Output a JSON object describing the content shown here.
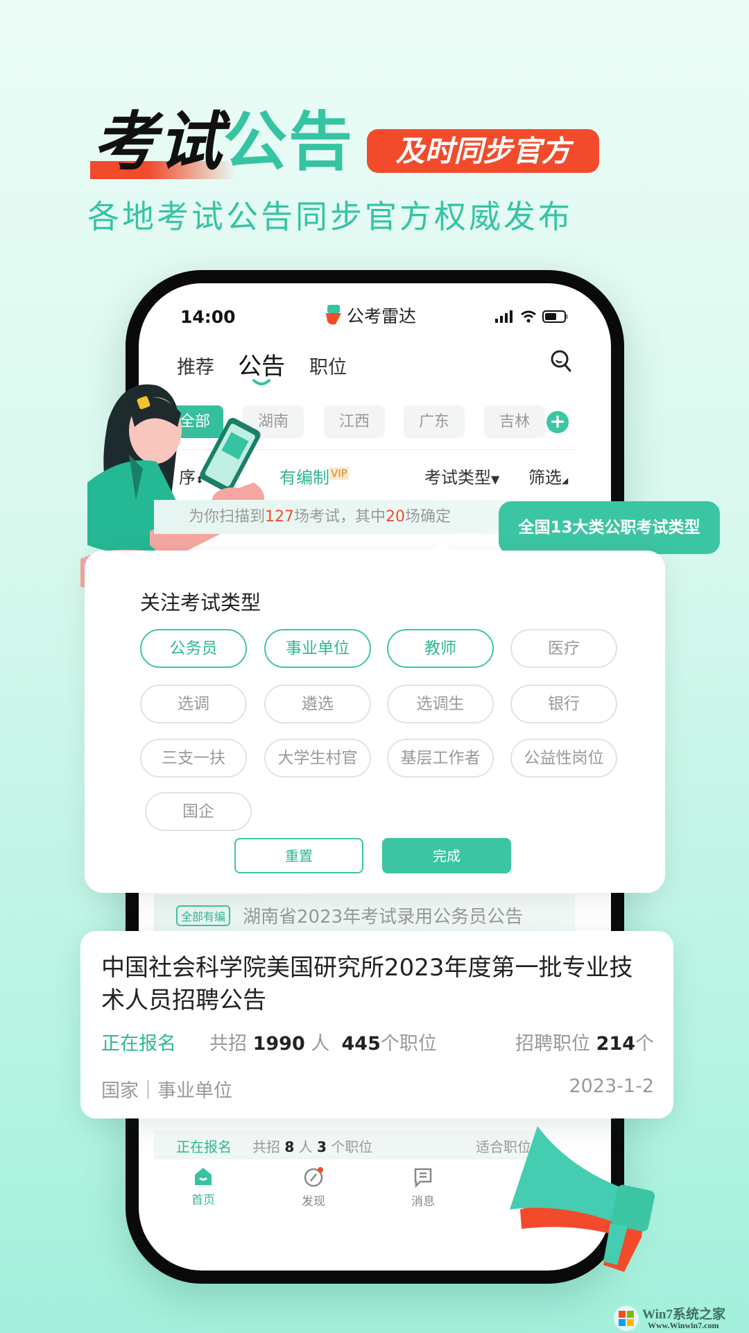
{
  "hero": {
    "title_dark": "考试",
    "title_green": "公告",
    "badge": "及时同步官方",
    "subtitle": "各地考试公告同步官方权威发布"
  },
  "status_bar": {
    "time": "14:00",
    "app_name": "公考雷达"
  },
  "top_tabs": [
    {
      "label": "推荐"
    },
    {
      "label": "公告",
      "active": true
    },
    {
      "label": "职位"
    }
  ],
  "regions": [
    {
      "label": "全部",
      "active": true
    },
    {
      "label": "湖南"
    },
    {
      "label": "江西"
    },
    {
      "label": "广东"
    },
    {
      "label": "吉林"
    }
  ],
  "filters": {
    "sort": "序",
    "only_bianzhi": "有编制",
    "vip": "VIP",
    "exam_type": "考试类型",
    "filter": "筛选"
  },
  "scan": {
    "prefix": "为你扫描到",
    "count1": "127",
    "mid": "场考试，其中",
    "count2": "20",
    "suffix": "场确定"
  },
  "tooltip": "全国13大类公职考试类型",
  "popup": {
    "title": "关注考试类型",
    "options": [
      {
        "label": "公务员",
        "selected": true
      },
      {
        "label": "事业单位",
        "selected": true
      },
      {
        "label": "教师",
        "selected": true
      },
      {
        "label": "医疗"
      },
      {
        "label": "选调"
      },
      {
        "label": "遴选"
      },
      {
        "label": "选调生"
      },
      {
        "label": "银行"
      },
      {
        "label": "三支一扶"
      },
      {
        "label": "大学生村官"
      },
      {
        "label": "基层工作者"
      },
      {
        "label": "公益性岗位"
      },
      {
        "label": "国企"
      }
    ],
    "reset": "重置",
    "done": "完成"
  },
  "list_bg": {
    "tag": "全部有编",
    "title": "湖南省2023年考试录用公务员公告",
    "status": "正在报名",
    "recruit_prefix": "共招",
    "people": "8",
    "people_unit": "人",
    "positions": "3",
    "positions_unit": "个职位",
    "fit": "适合职位"
  },
  "card": {
    "title": "中国社会科学院美国研究所2023年度第一批专业技术人员招聘公告",
    "status": "正在报名",
    "recruit_prefix": "共招",
    "people": "1990",
    "people_unit": "人",
    "positions": "445",
    "positions_unit": "个职位",
    "job_label": "招聘职位",
    "job_count": "214",
    "job_unit": "个",
    "category": "国家｜事业单位",
    "date": "2023-1-2"
  },
  "tabbar": [
    {
      "label": "首页",
      "active": true,
      "icon": "home-icon"
    },
    {
      "label": "发现",
      "icon": "compass-icon"
    },
    {
      "label": "消息",
      "icon": "message-icon"
    }
  ],
  "watermark": {
    "brand": "Win7系统之家",
    "url": "Www.Winwin7.com"
  },
  "colors": {
    "accent": "#3cc5a3",
    "red": "#f24b2c"
  }
}
